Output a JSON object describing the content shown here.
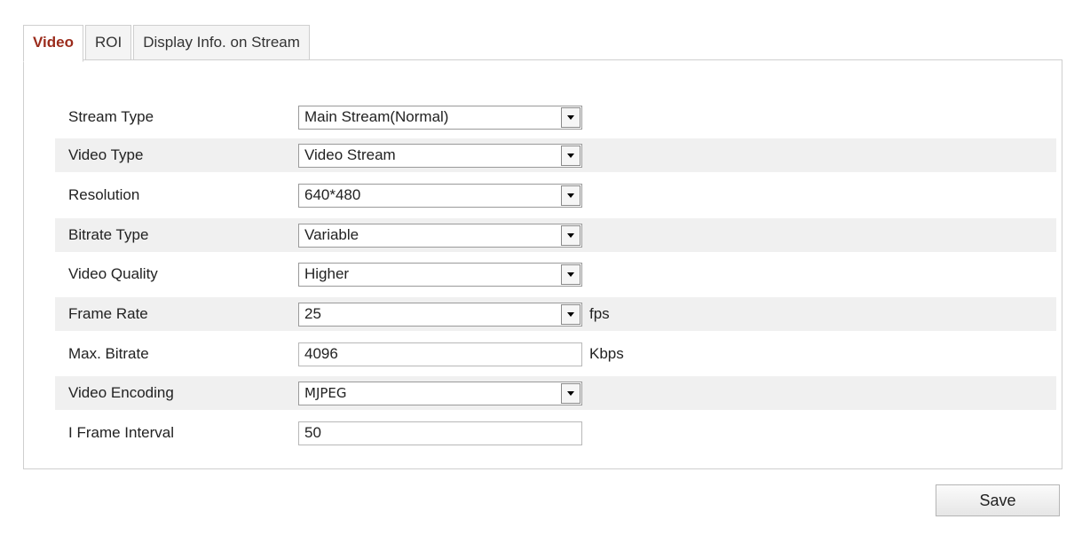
{
  "tabs": [
    {
      "label": "Video",
      "active": true
    },
    {
      "label": "ROI",
      "active": false
    },
    {
      "label": "Display Info. on Stream",
      "active": false
    }
  ],
  "fields": {
    "stream_type": {
      "label": "Stream Type",
      "value": "Main Stream(Normal)"
    },
    "video_type": {
      "label": "Video Type",
      "value": "Video Stream"
    },
    "resolution": {
      "label": "Resolution",
      "value": "640*480"
    },
    "bitrate_type": {
      "label": "Bitrate Type",
      "value": "Variable"
    },
    "video_quality": {
      "label": "Video Quality",
      "value": "Higher"
    },
    "frame_rate": {
      "label": "Frame Rate",
      "value": "25",
      "unit": "fps"
    },
    "max_bitrate": {
      "label": "Max. Bitrate",
      "value": "4096",
      "unit": "Kbps"
    },
    "video_encoding": {
      "label": "Video Encoding",
      "value": "MJPEG"
    },
    "i_frame_interval": {
      "label": "I Frame Interval",
      "value": "50"
    }
  },
  "save_label": "Save",
  "colors": {
    "active_tab": "#9b2c1c",
    "row_shade": "#f0f0f0",
    "border": "#cfcfcf"
  }
}
